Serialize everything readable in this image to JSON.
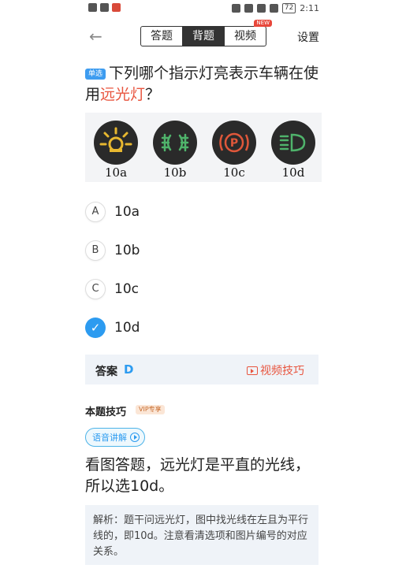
{
  "status_bar": {
    "time": "2:11",
    "battery": "72",
    "icons_left": [
      "alert-icon",
      "wifi-icon",
      "app-notification-icon"
    ],
    "icons_right": [
      "eye-icon",
      "nfc-icon",
      "mute-icon",
      "vibrate-icon"
    ]
  },
  "nav": {
    "tabs": [
      {
        "label": "答题",
        "active": false
      },
      {
        "label": "背题",
        "active": true
      },
      {
        "label": "视频",
        "active": false,
        "badge": "NEW"
      }
    ],
    "settings_label": "设置"
  },
  "question": {
    "type_badge": "单选",
    "text_before": "下列哪个指示灯亮表示车辆在使用",
    "highlight": "远光灯",
    "text_after": "？"
  },
  "image_labels": [
    "10a",
    "10b",
    "10c",
    "10d"
  ],
  "options": [
    {
      "letter": "A",
      "text": "10a",
      "selected": false
    },
    {
      "letter": "B",
      "text": "10b",
      "selected": false
    },
    {
      "letter": "C",
      "text": "10c",
      "selected": false
    },
    {
      "letter": "D",
      "text": "10d",
      "selected": true
    }
  ],
  "answer": {
    "label": "答案",
    "value": "D",
    "video_tip_label": "视频技巧"
  },
  "tips": {
    "title": "本题技巧",
    "vip_badge": "VIP专享",
    "voice_button": "语音讲解",
    "body": "看图答题，远光灯是平直的光线，所以选10d。",
    "analysis": "解析：题干问远光灯，图中找光线在左且为平行线的，即10d。注意看清选项和图片编号的对应关系。"
  },
  "colors": {
    "accent_blue": "#2c9bf0",
    "highlight_red": "#e8553f",
    "panel_bg": "#eff3f8"
  }
}
